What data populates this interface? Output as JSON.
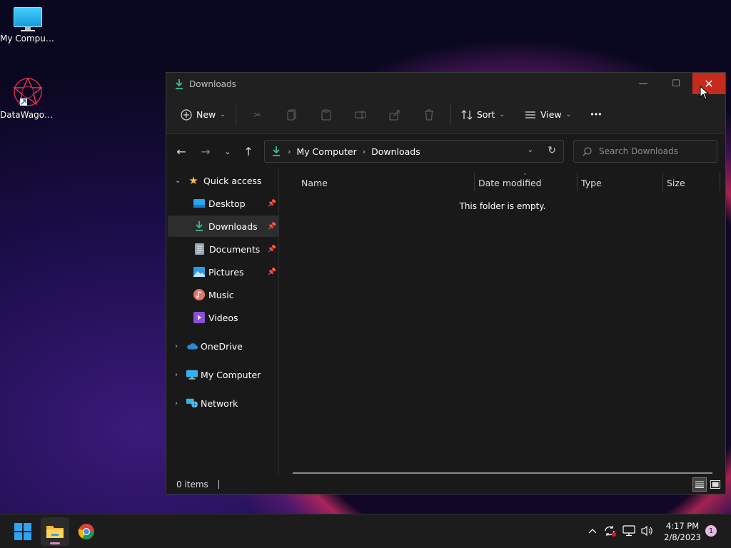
{
  "desktop": {
    "icons": [
      {
        "label": "My Computer",
        "icon": "monitor-icon"
      },
      {
        "label": "DataWagon...",
        "icon": "datawagon-icon"
      }
    ]
  },
  "window": {
    "title": "Downloads",
    "buttons": {
      "minimize": "—",
      "maximize": "☐",
      "close": "✕"
    }
  },
  "toolbar": {
    "new_label": "New",
    "sort_label": "Sort",
    "view_label": "View",
    "more_label": "•••"
  },
  "address": {
    "crumbs": [
      "My Computer",
      "Downloads"
    ],
    "search_placeholder": "Search Downloads"
  },
  "nav": {
    "quick_access": "Quick access",
    "items": [
      {
        "label": "Desktop",
        "pinned": true
      },
      {
        "label": "Downloads",
        "pinned": true,
        "selected": true
      },
      {
        "label": "Documents",
        "pinned": true
      },
      {
        "label": "Pictures",
        "pinned": true
      },
      {
        "label": "Music",
        "pinned": false
      },
      {
        "label": "Videos",
        "pinned": false
      }
    ],
    "roots": [
      "OneDrive",
      "My Computer",
      "Network"
    ]
  },
  "content": {
    "columns": [
      "Name",
      "Date modified",
      "Type",
      "Size"
    ],
    "empty_message": "This folder is empty."
  },
  "status": {
    "items_count": "0 items"
  },
  "taskbar": {
    "time": "4:17 PM",
    "date": "2/8/2023",
    "notification_count": "1"
  },
  "colors": {
    "accent_close": "#c42b1c",
    "window_bg": "#191919",
    "downloads_green": "#3dbf8a",
    "start_blue": "#2aa4f4"
  }
}
